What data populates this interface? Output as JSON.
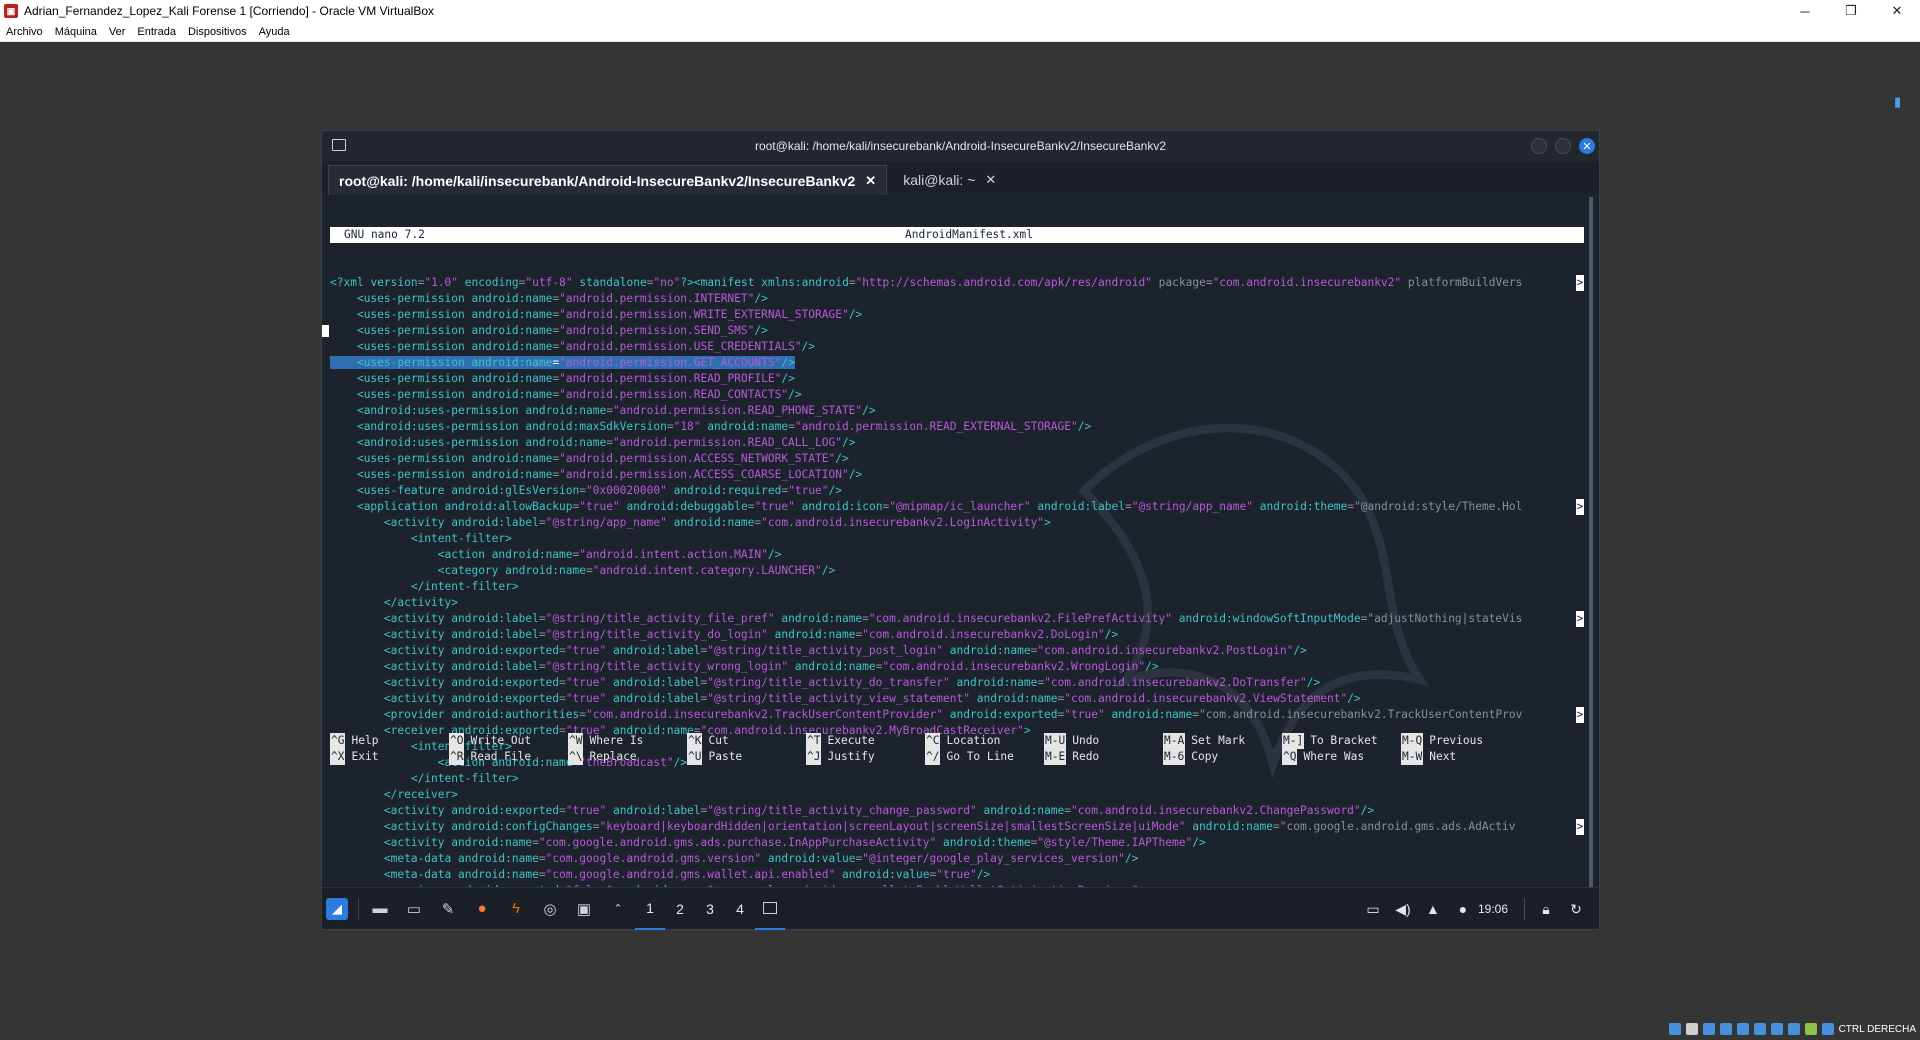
{
  "host": {
    "window_title": "Adrian_Fernandez_Lopez_Kali Forense 1 [Corriendo] - Oracle VM VirtualBox",
    "menu": [
      "Archivo",
      "Máquina",
      "Ver",
      "Entrada",
      "Dispositivos",
      "Ayuda"
    ],
    "host_key_label": "CTRL DERECHA"
  },
  "terminal": {
    "title": "root@kali: /home/kali/insecurebank/Android-InsecureBankv2/InsecureBankv2",
    "tabs": [
      {
        "label": "root@kali: /home/kali/insecurebank/Android-InsecureBankv2/InsecureBankv2",
        "active": true
      },
      {
        "label": "kali@kali: ~",
        "active": false
      }
    ]
  },
  "nano": {
    "version": "GNU nano 7.2",
    "filename": "AndroidManifest.xml",
    "lines": [
      "<?xml version=\"1.0\" encoding=\"utf-8\" standalone=\"no\"?><manifest xmlns:android=\"http://schemas.android.com/apk/res/android\" package=\"com.android.insecurebankv2\" platformBuildVers",
      "    <uses-permission android:name=\"android.permission.INTERNET\"/>",
      "    <uses-permission android:name=\"android.permission.WRITE_EXTERNAL_STORAGE\"/>",
      "    <uses-permission android:name=\"android.permission.SEND_SMS\"/>",
      "    <uses-permission android:name=\"android.permission.USE_CREDENTIALS\"/>",
      "    <uses-permission android:name=\"android.permission.GET_ACCOUNTS\"/>",
      "    <uses-permission android:name=\"android.permission.READ_PROFILE\"/>",
      "    <uses-permission android:name=\"android.permission.READ_CONTACTS\"/>",
      "    <android:uses-permission android:name=\"android.permission.READ_PHONE_STATE\"/>",
      "    <android:uses-permission android:maxSdkVersion=\"18\" android:name=\"android.permission.READ_EXTERNAL_STORAGE\"/>",
      "    <android:uses-permission android:name=\"android.permission.READ_CALL_LOG\"/>",
      "    <uses-permission android:name=\"android.permission.ACCESS_NETWORK_STATE\"/>",
      "    <uses-permission android:name=\"android.permission.ACCESS_COARSE_LOCATION\"/>",
      "    <uses-feature android:glEsVersion=\"0x00020000\" android:required=\"true\"/>",
      "    <application android:allowBackup=\"true\" android:debuggable=\"true\" android:icon=\"@mipmap/ic_launcher\" android:label=\"@string/app_name\" android:theme=\"@android:style/Theme.Hol",
      "        <activity android:label=\"@string/app_name\" android:name=\"com.android.insecurebankv2.LoginActivity\">",
      "            <intent-filter>",
      "                <action android:name=\"android.intent.action.MAIN\"/>",
      "                <category android:name=\"android.intent.category.LAUNCHER\"/>",
      "            </intent-filter>",
      "        </activity>",
      "        <activity android:label=\"@string/title_activity_file_pref\" android:name=\"com.android.insecurebankv2.FilePrefActivity\" android:windowSoftInputMode=\"adjustNothing|stateVis",
      "        <activity android:label=\"@string/title_activity_do_login\" android:name=\"com.android.insecurebankv2.DoLogin\"/>",
      "        <activity android:exported=\"true\" android:label=\"@string/title_activity_post_login\" android:name=\"com.android.insecurebankv2.PostLogin\"/>",
      "        <activity android:label=\"@string/title_activity_wrong_login\" android:name=\"com.android.insecurebankv2.WrongLogin\"/>",
      "        <activity android:exported=\"true\" android:label=\"@string/title_activity_do_transfer\" android:name=\"com.android.insecurebankv2.DoTransfer\"/>",
      "        <activity android:exported=\"true\" android:label=\"@string/title_activity_view_statement\" android:name=\"com.android.insecurebankv2.ViewStatement\"/>",
      "        <provider android:authorities=\"com.android.insecurebankv2.TrackUserContentProvider\" android:exported=\"true\" android:name=\"com.android.insecurebankv2.TrackUserContentProv",
      "        <receiver android:exported=\"true\" android:name=\"com.android.insecurebankv2.MyBroadCastReceiver\">",
      "            <intent-filter>",
      "                <action android:name=\"theBroadcast\"/>",
      "            </intent-filter>",
      "        </receiver>",
      "        <activity android:exported=\"true\" android:label=\"@string/title_activity_change_password\" android:name=\"com.android.insecurebankv2.ChangePassword\"/>",
      "        <activity android:configChanges=\"keyboard|keyboardHidden|orientation|screenLayout|screenSize|smallestScreenSize|uiMode\" android:name=\"com.google.android.gms.ads.AdActiv",
      "        <activity android:name=\"com.google.android.gms.ads.purchase.InAppPurchaseActivity\" android:theme=\"@style/Theme.IAPTheme\"/>",
      "        <meta-data android:name=\"com.google.android.gms.version\" android:value=\"@integer/google_play_services_version\"/>",
      "        <meta-data android:name=\"com.google.android.gms.wallet.api.enabled\" android:value=\"true\"/>",
      "        <receiver android:exported=\"false\" android:name=\"com.google.android.gms.wallet.EnableWalletOptimizationReceiver\">"
    ],
    "truncated_marker": ">",
    "highlighted_line_index": 5,
    "shortcuts_row1": [
      {
        "key": "^G",
        "label": "Help"
      },
      {
        "key": "^O",
        "label": "Write Out"
      },
      {
        "key": "^W",
        "label": "Where Is"
      },
      {
        "key": "^K",
        "label": "Cut"
      },
      {
        "key": "^T",
        "label": "Execute"
      },
      {
        "key": "^C",
        "label": "Location"
      },
      {
        "key": "M-U",
        "label": "Undo"
      },
      {
        "key": "M-A",
        "label": "Set Mark"
      },
      {
        "key": "M-]",
        "label": "To Bracket"
      },
      {
        "key": "M-Q",
        "label": "Previous"
      }
    ],
    "shortcuts_row2": [
      {
        "key": "^X",
        "label": "Exit"
      },
      {
        "key": "^R",
        "label": "Read File"
      },
      {
        "key": "^\\",
        "label": "Replace"
      },
      {
        "key": "^U",
        "label": "Paste"
      },
      {
        "key": "^J",
        "label": "Justify"
      },
      {
        "key": "^/",
        "label": "Go To Line"
      },
      {
        "key": "M-E",
        "label": "Redo"
      },
      {
        "key": "M-6",
        "label": "Copy"
      },
      {
        "key": "^Q",
        "label": "Where Was"
      },
      {
        "key": "M-W",
        "label": "Next"
      }
    ]
  },
  "taskbar": {
    "workspaces": [
      "1",
      "2",
      "3",
      "4"
    ],
    "active_workspace": "1",
    "clock": "19:06"
  },
  "colors": {
    "xml_tag": "#3fc3c9",
    "xml_value": "#b75ad7",
    "accent": "#2a7ce0",
    "terminal_bg": "#1d232d"
  }
}
